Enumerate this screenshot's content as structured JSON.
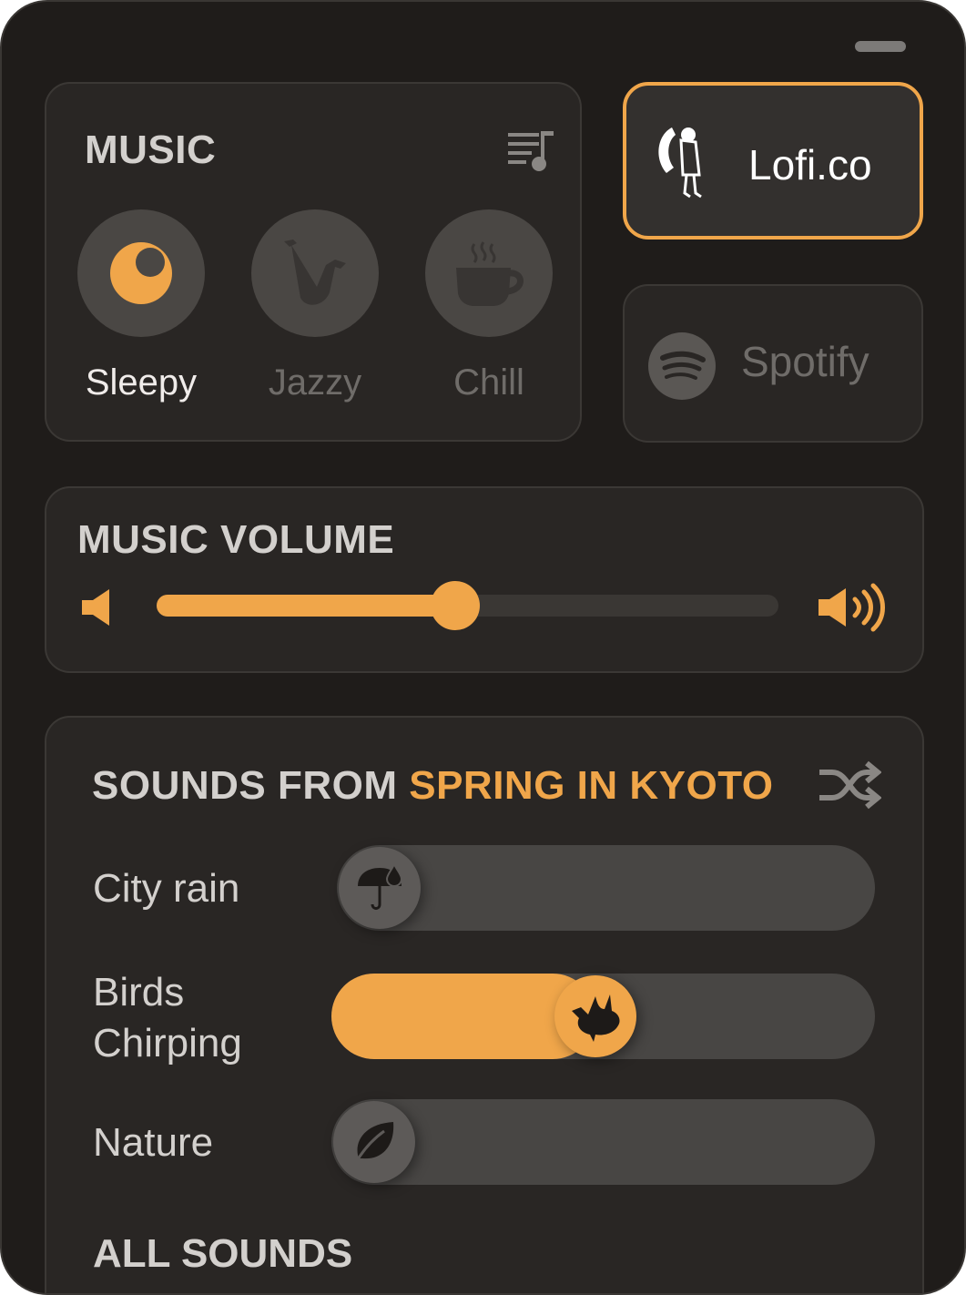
{
  "colors": {
    "accent": "#f0a64a",
    "background": "#1f1c1a",
    "panel": "#292624"
  },
  "music": {
    "title": "MUSIC",
    "queue_icon": "playlist-icon",
    "moods": [
      {
        "label": "Sleepy",
        "icon": "moon-icon",
        "active": true
      },
      {
        "label": "Jazzy",
        "icon": "saxophone-icon",
        "active": false
      },
      {
        "label": "Chill",
        "icon": "coffee-cup-icon",
        "active": false
      }
    ]
  },
  "providers": [
    {
      "name": "Lofi.co",
      "icon": "lofi-logo-icon",
      "selected": true
    },
    {
      "name": "Spotify",
      "icon": "spotify-icon",
      "selected": false
    }
  ],
  "volume": {
    "title": "MUSIC VOLUME",
    "level_fraction": 0.48
  },
  "sounds": {
    "title_prefix": "SOUNDS FROM ",
    "title_accent": "SPRING IN KYOTO",
    "items": [
      {
        "label": "City rain",
        "icon": "umbrella-rain-icon",
        "level_fraction": 0.0
      },
      {
        "label": "Birds Chirping",
        "label_line1": "Birds",
        "label_line2": "Chirping",
        "icon": "bird-icon",
        "level_fraction": 0.5
      },
      {
        "label": "Nature",
        "icon": "leaf-icon",
        "level_fraction": 0.0
      }
    ]
  },
  "all_sounds_title": "ALL SOUNDS"
}
